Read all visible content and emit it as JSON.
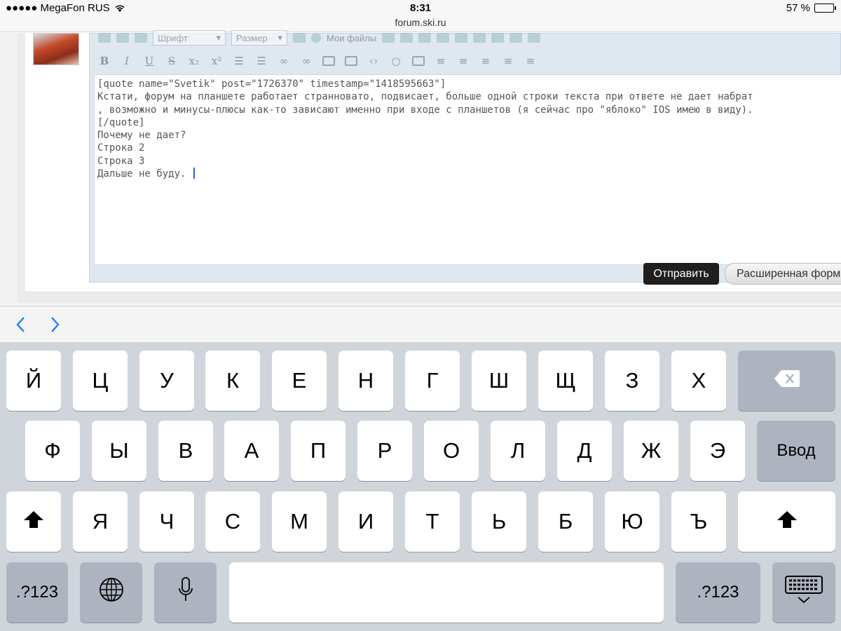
{
  "status_bar": {
    "carrier": "●●●●● MegaFon RUS",
    "time": "8:31",
    "url": "forum.ski.ru",
    "battery": "57 %",
    "battery_level": 0.57
  },
  "editor": {
    "font_select": "Шрифт",
    "size_select": "Размер",
    "my_files": "Мои файлы",
    "format_buttons": [
      "B",
      "I",
      "U",
      "S",
      "x₂",
      "x²"
    ],
    "text_lines": [
      "[quote name=\"Svetik\" post=\"1726370\" timestamp=\"1418595663\"]",
      "Кстати, форум на планшете работает странновато, подвисает, больше одной строки текста при ответе не дает набрат",
      ", возможно и минусы-плюсы как-то зависают именно при входе с планшетов (я сейчас про \"яблоко\" IOS имею в виду).",
      "[/quote]",
      "Почему не дает?",
      "Строка 2",
      "Строка 3",
      "Дальше не буду. "
    ]
  },
  "buttons": {
    "send": "Отправить",
    "advanced": "Расширенная форм"
  },
  "keyboard": {
    "row1": [
      "Й",
      "Ц",
      "У",
      "К",
      "Е",
      "Н",
      "Г",
      "Ш",
      "Щ",
      "З",
      "Х"
    ],
    "row2": [
      "Ф",
      "Ы",
      "В",
      "А",
      "П",
      "Р",
      "О",
      "Л",
      "Д",
      "Ж",
      "Э"
    ],
    "row3": [
      "Я",
      "Ч",
      "С",
      "М",
      "И",
      "Т",
      "Ь",
      "Б",
      "Ю",
      "Ъ"
    ],
    "enter": "Ввод",
    "numbers": ".?123"
  }
}
